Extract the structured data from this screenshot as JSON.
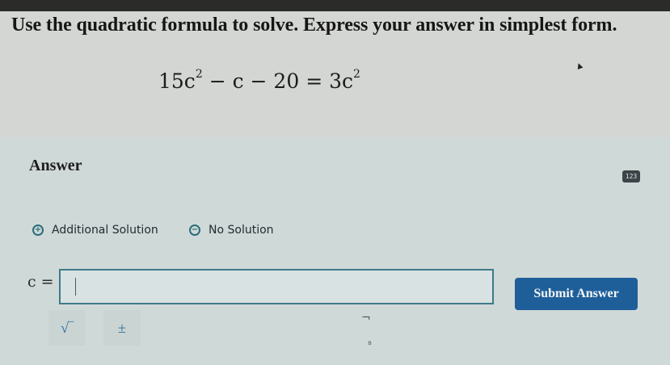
{
  "question": {
    "prompt": "Use the quadratic formula to solve. Express your answer in simplest form.",
    "equation": {
      "lhs_coefficient": "15c",
      "lhs_exponent": "2",
      "lhs_tail": " − c − 20 = 3c",
      "rhs_exponent": "2"
    }
  },
  "answer": {
    "title": "Answer",
    "keypad_icon": "keypad-icon",
    "options": [
      {
        "label": "Additional Solution",
        "symbol": "+"
      },
      {
        "label": "No Solution",
        "symbol": "−"
      }
    ],
    "variable_label": "c =",
    "input_value": "",
    "submit_label": "Submit Answer",
    "tools": [
      {
        "name": "square-root",
        "symbol": "√‾"
      },
      {
        "name": "plus-minus",
        "symbol": "±"
      }
    ]
  },
  "colors": {
    "accent": "#1f5f99",
    "option_ring": "#2b6d7a",
    "panel": "#cfd9d8"
  }
}
